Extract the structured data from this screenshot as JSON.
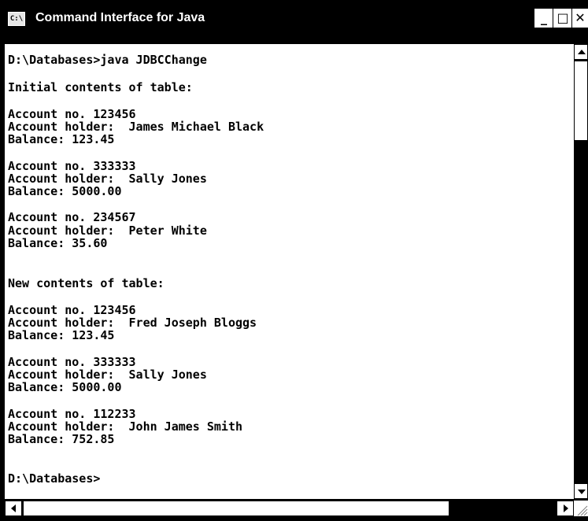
{
  "window": {
    "title": "Command Interface for Java",
    "icon_label": "C:\\",
    "buttons": {
      "minimize": "_",
      "maximize": "□",
      "close": "✕"
    }
  },
  "console": {
    "lines": [
      "D:\\Databases>java JDBCChange",
      "Initial contents of table:",
      "Account no. 123456",
      "Account holder:  James Michael Black",
      "Balance: 123.45",
      "Account no. 333333",
      "Account holder:  Sally Jones",
      "Balance: 5000.00",
      "Account no. 234567",
      "Account holder:  Peter White",
      "Balance: 35.60",
      "New contents of table:",
      "Account no. 123456",
      "Account holder:  Fred Joseph Bloggs",
      "Balance: 123.45",
      "Account no. 333333",
      "Account holder:  Sally Jones",
      "Balance: 5000.00",
      "Account no. 112233",
      "Account holder:  John James Smith",
      "Balance: 752.85",
      "D:\\Databases>"
    ]
  },
  "icons": {
    "scroll_up": "arrow-up-icon",
    "scroll_down": "arrow-down-icon",
    "scroll_left": "arrow-left-icon",
    "scroll_right": "arrow-right-icon",
    "resize_grip": "resize-grip-icon"
  },
  "colors": {
    "frame": "#000000",
    "console_bg": "#ffffff",
    "console_text": "#000000",
    "title_text": "#ffffff"
  }
}
